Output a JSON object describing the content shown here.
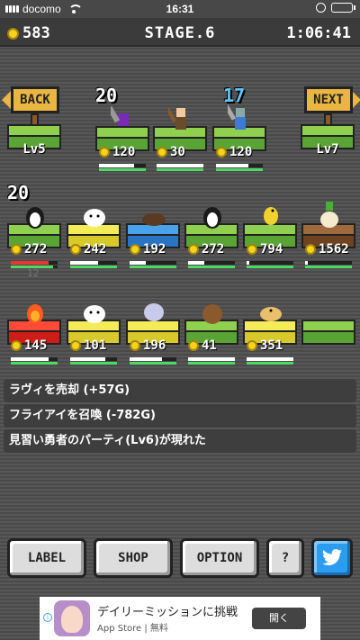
{
  "status": {
    "carrier": "docomo",
    "time": "16:31"
  },
  "hud": {
    "gold": "583",
    "stage": "STAGE.6",
    "clock": "1:06:41"
  },
  "nav": {
    "back": {
      "label": "BACK",
      "level": "Lv5"
    },
    "next": {
      "label": "NEXT",
      "level": "Lv7"
    }
  },
  "row1": [
    {
      "name": "purple-orb-sword-icon",
      "price": "120",
      "level": "20",
      "level_color": "white",
      "tile": "grass",
      "progress": 0.75,
      "hp": 1.0
    },
    {
      "name": "swordsman-icon",
      "price": "30",
      "level": "",
      "tile": "grass",
      "progress": 1.0,
      "hp": 1.0
    },
    {
      "name": "knight-icon",
      "price": "120",
      "level": "17",
      "level_color": "blue",
      "tile": "grass",
      "progress": 0.7,
      "hp": 1.0
    }
  ],
  "row2": [
    {
      "name": "penguin-icon",
      "price": "272",
      "level": "20",
      "level_color": "white",
      "tile": "grass",
      "progress": 0.8,
      "progress_red": true,
      "hp": 0.9
    },
    {
      "name": "white-cat-icon",
      "price": "242",
      "level": "",
      "tile": "yellow",
      "progress": 0.6,
      "hp": 1.0
    },
    {
      "name": "whale-icon",
      "price": "192",
      "level": "",
      "tile": "water",
      "progress": 0.35,
      "hp": 1.0
    },
    {
      "name": "penguin-icon",
      "price": "272",
      "level": "",
      "tile": "grass",
      "progress": 0.35,
      "hp": 1.0
    },
    {
      "name": "yellow-bird-icon",
      "price": "794",
      "level": "",
      "tile": "grass",
      "progress": 0.05,
      "hp": 1.0
    },
    {
      "name": "mandrake-icon",
      "price": "1562",
      "level": "",
      "tile": "dirt",
      "progress": 0.05,
      "hp": 1.0
    }
  ],
  "row2_ghost": "12",
  "row3": [
    {
      "name": "flame-icon",
      "price": "145",
      "tile": "red",
      "progress": 0.8,
      "hp": 1.0
    },
    {
      "name": "white-cat-icon",
      "price": "101",
      "tile": "yellow",
      "progress": 0.75,
      "hp": 1.0
    },
    {
      "name": "ghost-icon",
      "price": "196",
      "tile": "yellow",
      "progress": 0.7,
      "hp": 1.0
    },
    {
      "name": "brown-mole-icon",
      "price": "41",
      "tile": "grass",
      "progress": 1.0,
      "hp": 1.0
    },
    {
      "name": "bird-icon",
      "price": "351",
      "tile": "yellow",
      "progress": 1.0,
      "hp": 1.0
    },
    {
      "name": "empty-tile",
      "price": "",
      "tile": "grass",
      "progress": 0,
      "hp": 0
    }
  ],
  "log": [
    "ラヴィを売却 (+57G)",
    "フライアイを召喚 (-782G)",
    "見習い勇者のパーティ(Lv6)が現れた"
  ],
  "buttons": {
    "label": "LABEL",
    "shop": "SHOP",
    "option": "OPTION",
    "help": "?"
  },
  "colors": {
    "coin": "#f3d31c",
    "grass": "#8fd14f",
    "twitter": "#2c9cf0"
  },
  "ad": {
    "title": "デイリーミッションに挑戦",
    "store": "App Store",
    "price": "無料",
    "open": "開く"
  }
}
